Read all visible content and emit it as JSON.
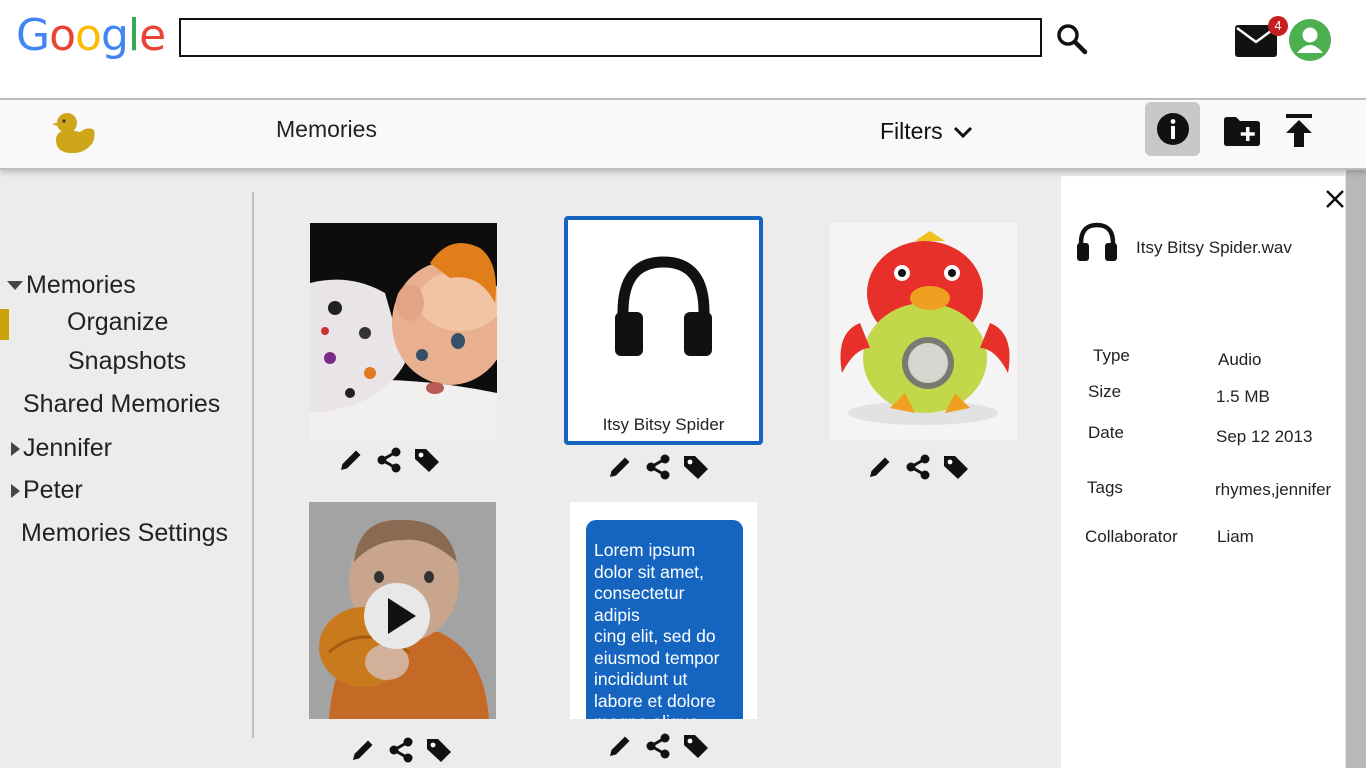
{
  "header": {
    "logo_letters": [
      "G",
      "o",
      "o",
      "g",
      "l",
      "e"
    ],
    "logo_colors": [
      "#4285F4",
      "#EA4335",
      "#FBBC05",
      "#4285F4",
      "#34A853",
      "#EA4335"
    ],
    "search": {
      "value": "",
      "placeholder": ""
    },
    "mail_badge": "4"
  },
  "appbar": {
    "title": "Memories",
    "filters_label": "Filters"
  },
  "sidebar": {
    "items": [
      {
        "label": "Memories"
      },
      {
        "label": "Organize"
      },
      {
        "label": "Snapshots"
      },
      {
        "label": "Shared Memories"
      },
      {
        "label": "Jennifer"
      },
      {
        "label": "Peter"
      },
      {
        "label": "Memories Settings"
      }
    ]
  },
  "grid": {
    "audio_tile_caption": "Itsy Bitsy Spider",
    "text_tile_body": "Lorem ipsum\ndolor sit amet,\nconsectetur adipis\ncing elit, sed do\neiusmod tempor\n incididunt ut\nlabore et dolore\nmagna aliqua."
  },
  "info_panel": {
    "filename": "Itsy Bitsy Spider.wav",
    "properties": [
      {
        "label": "Type",
        "value": "Audio"
      },
      {
        "label": "Size",
        "value": "1.5 MB"
      },
      {
        "label": "Date",
        "value": "Sep 12 2013"
      },
      {
        "label": "Tags",
        "value": "rhymes,jennifer"
      },
      {
        "label": "Collaborator",
        "value": "Liam"
      }
    ]
  },
  "colors": {
    "accent_blue": "#1565c0",
    "active_nav_bar": "#c9a20c",
    "badge_red": "#c51f1f",
    "avatar_green": "#4caf50"
  }
}
